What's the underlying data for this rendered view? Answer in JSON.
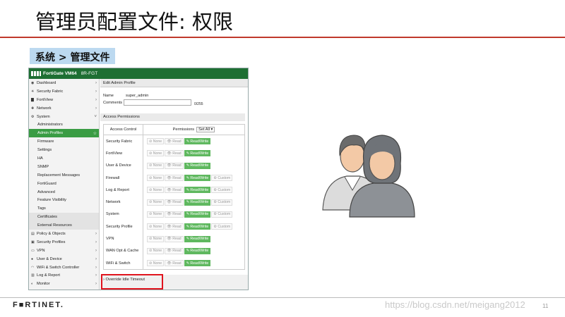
{
  "slide": {
    "title": "管理员配置文件: 权限",
    "breadcrumb": "系统 > 管理文件",
    "footer_brand": "F■RTINET.",
    "watermark": "https://blog.csdn.net/meigang2012",
    "page_number": "11"
  },
  "app": {
    "product": "FortiGate VM64",
    "hostname": "8R-FGT",
    "logo_icon": "fortinet-logo-icon"
  },
  "sidebar": {
    "items": [
      {
        "label": "Dashboard",
        "icon": "dashboard-icon",
        "type": "top"
      },
      {
        "label": "Security Fabric",
        "icon": "fabric-icon",
        "type": "top"
      },
      {
        "label": "FortiView",
        "icon": "chart-icon",
        "type": "top"
      },
      {
        "label": "Network",
        "icon": "network-icon",
        "type": "top"
      },
      {
        "label": "System",
        "icon": "gear-icon",
        "type": "top-open"
      },
      {
        "label": "Administrators",
        "type": "sub"
      },
      {
        "label": "Admin Profiles",
        "type": "sub-active"
      },
      {
        "label": "Firmware",
        "type": "sub"
      },
      {
        "label": "Settings",
        "type": "sub"
      },
      {
        "label": "HA",
        "type": "sub"
      },
      {
        "label": "SNMP",
        "type": "sub"
      },
      {
        "label": "Replacement Messages",
        "type": "sub"
      },
      {
        "label": "FortiGuard",
        "type": "sub"
      },
      {
        "label": "Advanced",
        "type": "sub"
      },
      {
        "label": "Feature Visibility",
        "type": "sub"
      },
      {
        "label": "Tags",
        "type": "sub"
      },
      {
        "label": "Certificates",
        "type": "sub-group"
      },
      {
        "label": "External Resources",
        "type": "sub-group"
      },
      {
        "label": "Policy & Objects",
        "icon": "doc-icon",
        "type": "top"
      },
      {
        "label": "Security Profiles",
        "icon": "lock-icon",
        "type": "top"
      },
      {
        "label": "VPN",
        "icon": "vpn-icon",
        "type": "top"
      },
      {
        "label": "User & Device",
        "icon": "user-icon",
        "type": "top"
      },
      {
        "label": "WiFi & Switch Controller",
        "icon": "wifi-icon",
        "type": "top"
      },
      {
        "label": "Log & Report",
        "icon": "bar-chart-icon",
        "type": "top"
      },
      {
        "label": "Monitor",
        "icon": "monitor-icon",
        "type": "top"
      }
    ]
  },
  "main": {
    "header": "Edit Admin Profile",
    "name_label": "Name",
    "name_value": "super_admin",
    "comments_label": "Comments",
    "comments_counter": "0/255",
    "section_title": "Access Permissions",
    "col_access": "Access Control",
    "col_permissions": "Permissions",
    "set_all": "Set All ▾",
    "opt_none": "⊘ None",
    "opt_read": "👁 Read",
    "opt_rw": "✎ Read/Write",
    "opt_custom": "⚙ Custom",
    "rows": [
      {
        "label": "Security Fabric",
        "custom": false
      },
      {
        "label": "FortiView",
        "custom": false
      },
      {
        "label": "User & Device",
        "custom": false
      },
      {
        "label": "Firewall",
        "custom": true
      },
      {
        "label": "Log & Report",
        "custom": true
      },
      {
        "label": "Network",
        "custom": true
      },
      {
        "label": "System",
        "custom": true
      },
      {
        "label": "Security Profile",
        "custom": true
      },
      {
        "label": "VPN",
        "custom": false
      },
      {
        "label": "WAN Opt & Cache",
        "custom": false
      },
      {
        "label": "WiFi & Switch",
        "custom": false
      }
    ],
    "override_label": "Override Idle Timeout"
  },
  "colors": {
    "topbar": "#1e6f33",
    "active": "#3a9c44",
    "readwrite": "#5fb85f",
    "highlight_box": "#e0141e",
    "title_rule": "#c0392b"
  }
}
